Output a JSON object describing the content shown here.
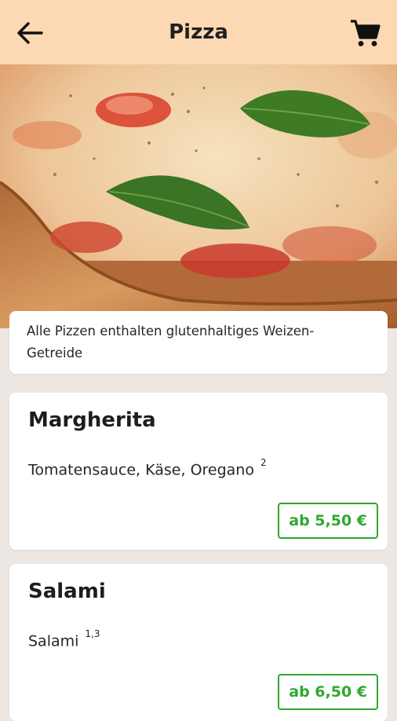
{
  "header": {
    "title": "Pizza",
    "back_icon": "arrow-left-icon",
    "cart_icon": "shopping-cart-icon"
  },
  "notice": {
    "text": "Alle Pizzen enthalten glutenhaltiges Weizen-Getreide"
  },
  "items": [
    {
      "name": "Margherita",
      "description": "Tomatensauce, Käse, Oregano",
      "footnote": "2",
      "price": "ab 5,50 €"
    },
    {
      "name": "Salami",
      "description": "Salami",
      "footnote": "1,3",
      "price": "ab 6,50 €"
    }
  ],
  "colors": {
    "appbar": "#fcd9b3",
    "background": "#ede8e4",
    "price_accent": "#2fa82f"
  }
}
